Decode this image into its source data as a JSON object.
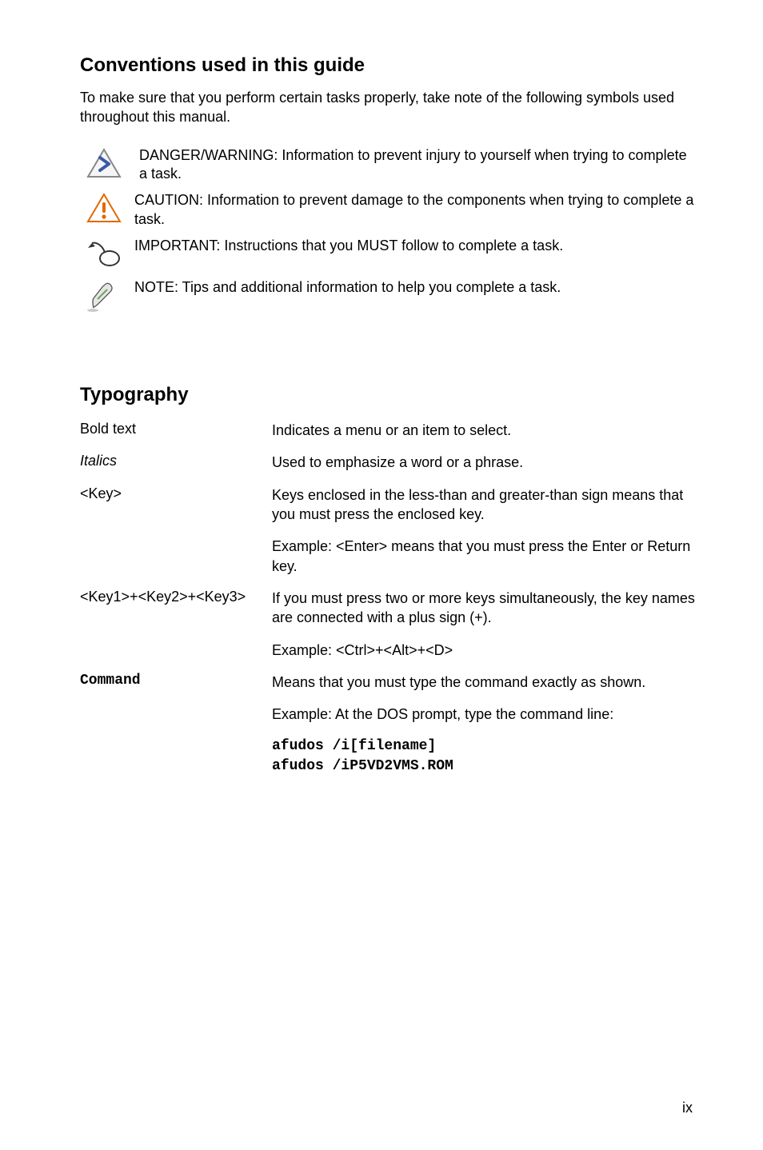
{
  "section1": {
    "heading": "Conventions used in this guide",
    "intro": "To make sure that you perform certain tasks properly, take note of the following symbols used throughout this manual.",
    "notes": {
      "danger": "DANGER/WARNING: Information to prevent injury to yourself when trying to complete a task.",
      "caution": "CAUTION: Information to prevent damage to the components when trying to complete a task.",
      "important": "IMPORTANT: Instructions that you MUST follow to complete a task.",
      "note": "NOTE: Tips and additional information to help you complete a task."
    }
  },
  "section2": {
    "heading": "Typography",
    "rows": {
      "bold": {
        "label": "Bold text",
        "desc": "Indicates a menu or an item to select."
      },
      "italics": {
        "label": "Italics",
        "desc": "Used to emphasize a word or a phrase."
      },
      "key": {
        "label": "<Key>",
        "desc1": "Keys enclosed in the less-than and greater-than sign means that you must press the enclosed key.",
        "desc2": "Example: <Enter> means that you must press the Enter or Return key."
      },
      "keys": {
        "label": "<Key1>+<Key2>+<Key3>",
        "desc1": "If you must press two or more keys simultaneously, the key names are connected with a plus sign (+).",
        "desc2": "Example: <Ctrl>+<Alt>+<D>"
      },
      "command": {
        "label": "Command",
        "desc1": "Means that you must type the command exactly as shown.",
        "desc2": "Example: At the DOS prompt, type the command line:",
        "code1": "afudos /i[filename]",
        "code2": "afudos /iP5VD2VMS.ROM"
      }
    }
  },
  "pagenum": "ix"
}
